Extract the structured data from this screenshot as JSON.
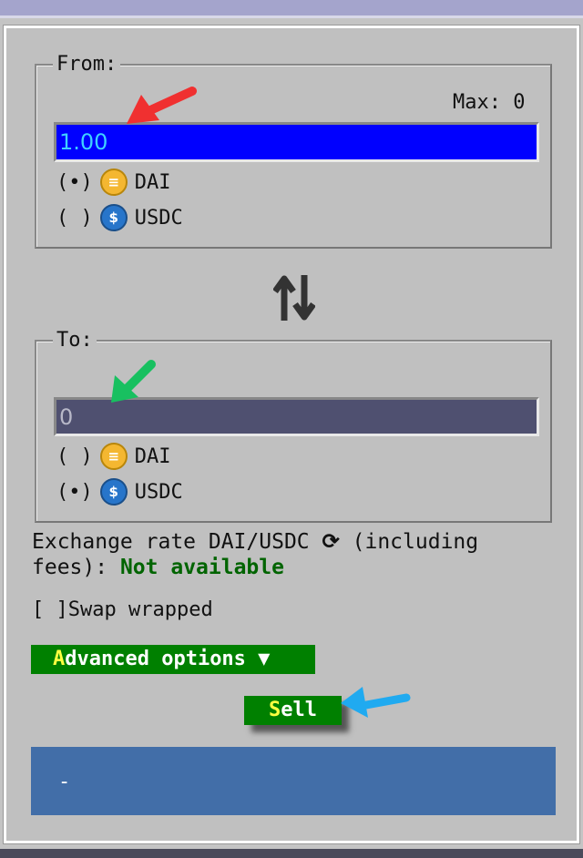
{
  "from": {
    "legend": "From:",
    "max_label": "Max: 0",
    "amount": "1.00",
    "options": [
      {
        "radio": "(•)",
        "token": "DAI",
        "selected": true
      },
      {
        "radio": "( )",
        "token": "USDC",
        "selected": false
      }
    ]
  },
  "swap_icon": "swap-vertical-arrows-icon",
  "to": {
    "legend": "To:",
    "amount": "0",
    "options": [
      {
        "radio": "( )",
        "token": "DAI",
        "selected": false
      },
      {
        "radio": "(•)",
        "token": "USDC",
        "selected": true
      }
    ]
  },
  "exchange": {
    "line1": "Exchange rate DAI/USDC",
    "refresh_icon": "refresh-icon",
    "line1b": "(including",
    "line2": "fees):",
    "status": "Not available"
  },
  "swap_wrapped": {
    "checkbox": "[ ]",
    "label": "Swap wrapped"
  },
  "advanced": {
    "hotkey": "A",
    "rest": "dvanced options ▼"
  },
  "sell": {
    "hotkey": "S",
    "rest": "ell"
  },
  "status_box": {
    "text": "-"
  },
  "colors": {
    "from_input": "#0000ff",
    "to_input": "#4f5070",
    "button": "#008000",
    "status_box": "#426ea8",
    "status_text": "#006400"
  }
}
